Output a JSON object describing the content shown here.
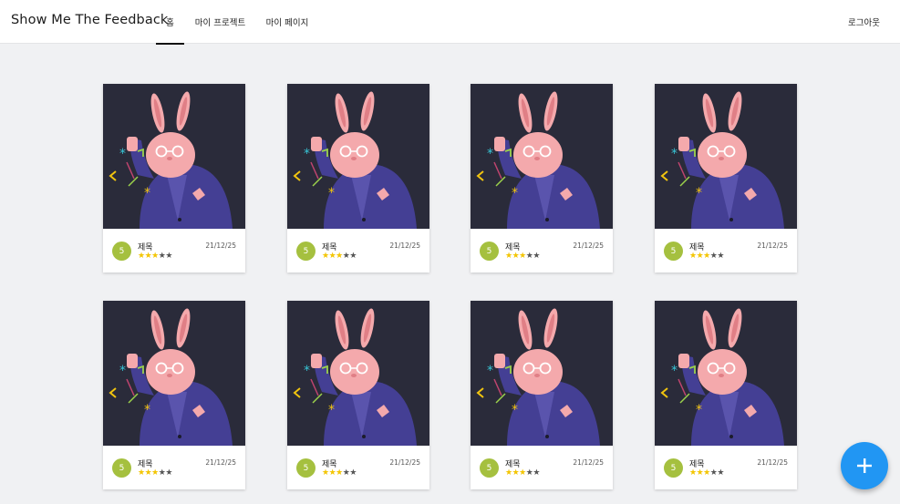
{
  "header": {
    "brand": "Show Me The Feedback",
    "tabs": [
      {
        "label": "홈",
        "active": true
      },
      {
        "label": "마이 프로젝트",
        "active": false
      },
      {
        "label": "마이 페이지",
        "active": false
      }
    ],
    "logout_label": "로그아웃"
  },
  "cards": [
    {
      "avatar": "5",
      "title": "제목",
      "rating": 3,
      "max_rating": 5,
      "date": "21/12/25"
    },
    {
      "avatar": "5",
      "title": "제목",
      "rating": 3,
      "max_rating": 5,
      "date": "21/12/25"
    },
    {
      "avatar": "5",
      "title": "제목",
      "rating": 3,
      "max_rating": 5,
      "date": "21/12/25"
    },
    {
      "avatar": "5",
      "title": "제목",
      "rating": 3,
      "max_rating": 5,
      "date": "21/12/25"
    },
    {
      "avatar": "5",
      "title": "제목",
      "rating": 3,
      "max_rating": 5,
      "date": "21/12/25"
    },
    {
      "avatar": "5",
      "title": "제목",
      "rating": 3,
      "max_rating": 5,
      "date": "21/12/25"
    },
    {
      "avatar": "5",
      "title": "제목",
      "rating": 3,
      "max_rating": 5,
      "date": "21/12/25"
    },
    {
      "avatar": "5",
      "title": "제목",
      "rating": 3,
      "max_rating": 5,
      "date": "21/12/25"
    }
  ],
  "fab": {
    "icon": "plus-icon"
  },
  "colors": {
    "accent": "#2196f3",
    "avatar": "#a5c03f",
    "star_on": "#f3c500",
    "star_off": "#555555",
    "thumb_bg": "#2a2b3a"
  }
}
